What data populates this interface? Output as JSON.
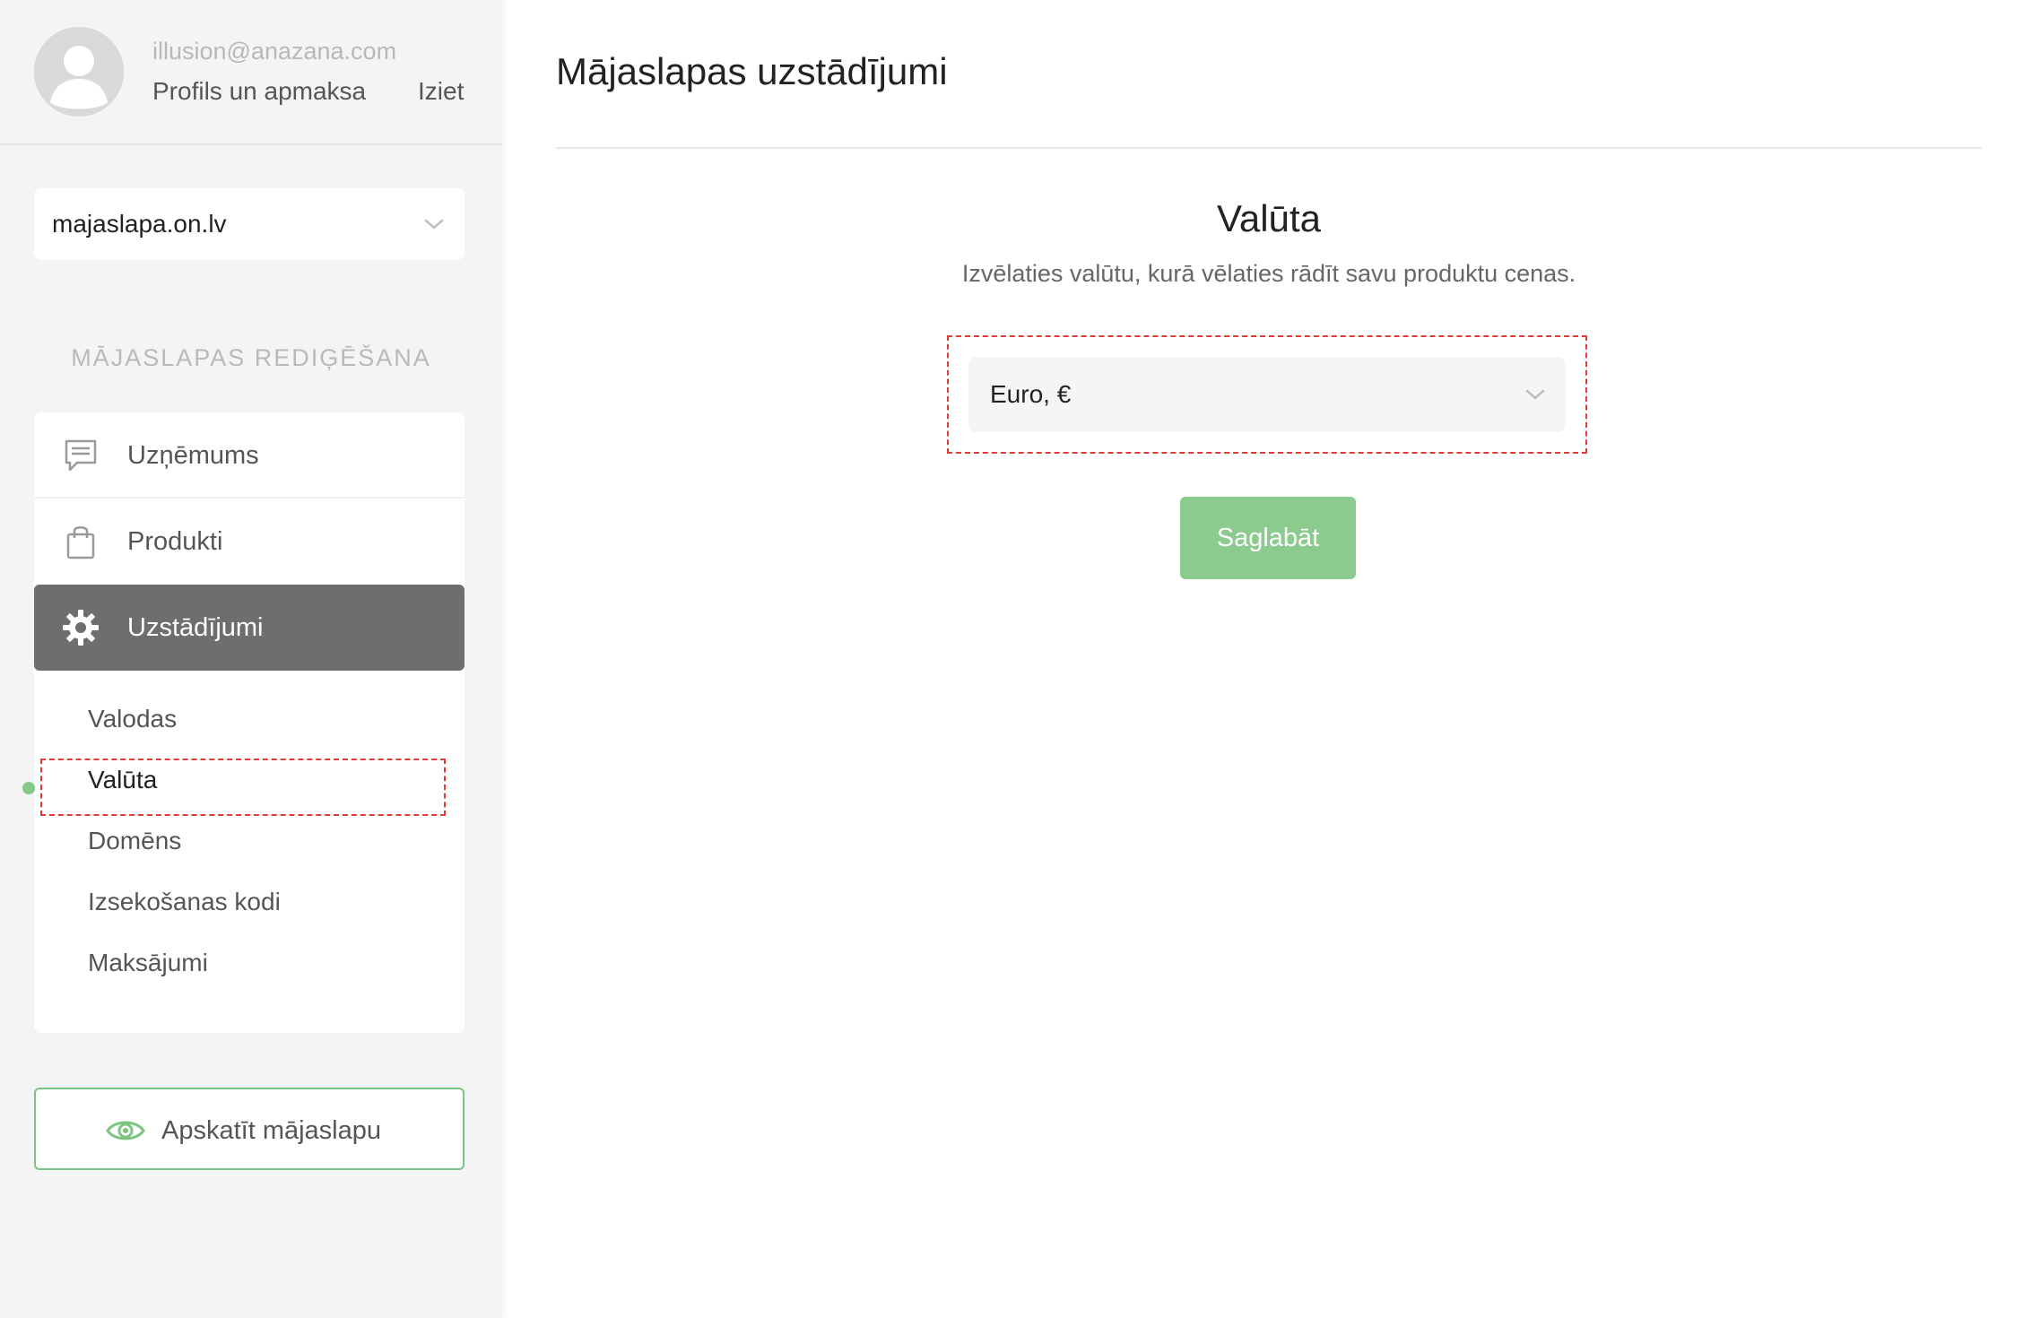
{
  "user": {
    "email": "illusion@anazana.com",
    "profile_label": "Profils un apmaksa",
    "logout_label": "Iziet"
  },
  "site_selector": {
    "value": "majaslapa.on.lv",
    "icon": "chevron-down-icon"
  },
  "sidebar": {
    "section_heading": "MĀJASLAPAS REDIĢĒŠANA",
    "items": [
      {
        "label": "Uzņēmums",
        "icon": "chat-icon"
      },
      {
        "label": "Produkti",
        "icon": "shopping-bag-icon"
      },
      {
        "label": "Uzstādījumi",
        "icon": "gear-icon",
        "active": true
      }
    ],
    "sub_items": [
      {
        "label": "Valodas"
      },
      {
        "label": "Valūta",
        "selected": true
      },
      {
        "label": "Domēns"
      },
      {
        "label": "Izsekošanas kodi"
      },
      {
        "label": "Maksājumi"
      }
    ],
    "view_site_label": "Apskatīt mājaslapu"
  },
  "main": {
    "page_title": "Mājaslapas uzstādījumi",
    "section_title": "Valūta",
    "section_description": "Izvēlaties valūtu, kurā vēlaties rādīt savu produktu cenas.",
    "currency_value": "Euro, €",
    "save_label": "Saglabāt"
  },
  "colors": {
    "accent_green": "#86c78a",
    "active_nav_bg": "#6e6e6e",
    "highlight_red": "#e53935"
  }
}
